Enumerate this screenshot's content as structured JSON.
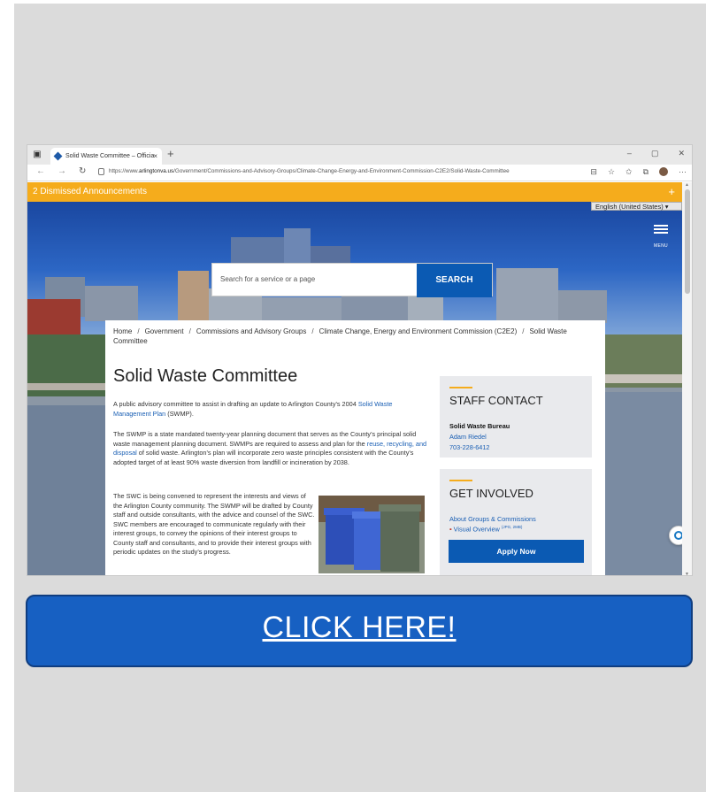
{
  "browser": {
    "tab_title": "Solid Waste Committee – Officia",
    "tab_close": "×",
    "new_tab": "+",
    "window_controls": [
      "–",
      "▢",
      "✕"
    ],
    "url_prefix": "https://www.",
    "url_domain": "arlingtonva.us",
    "url_path": "/Government/Commissions-and-Advisory-Groups/Climate-Change-Energy-and-Environment-Commission-C2E2/Solid-Waste-Committee",
    "more_icon": "···"
  },
  "page": {
    "announcement": "2 Dismissed Announcements",
    "announcement_plus": "+",
    "language": "English (United States)",
    "menu_label": "MENU",
    "search_placeholder": "Search for a service or a page",
    "search_button": "SEARCH",
    "breadcrumb": [
      "Home",
      "Government",
      "Commissions and Advisory Groups",
      "Climate Change, Energy and Environment Commission (C2E2)",
      "Solid Waste Committee"
    ],
    "breadcrumb_separator": "/",
    "title": "Solid Waste Committee",
    "intro_before_link": "A public advisory committee to assist in drafting an update to Arlington County's 2004 ",
    "intro_link": "Solid Waste Management Plan",
    "intro_after_link": " (SWMP).",
    "swmp_before_link": "The SWMP is a state mandated twenty-year planning document that serves as the County's principal solid waste management planning document. SWMPs are required to assess and plan for the ",
    "swmp_link": "reuse, recycling, and disposal",
    "swmp_after_link": " of solid waste. Arlington's plan will incorporate zero waste principles consistent with the County's adopted target of at least 90% waste diversion from landfill or incineration by 2038.",
    "swc_paragraph": "The SWC is being convened to represent the interests and views of the Arlington County community. The SWMP will be drafted by County staff and outside consultants, with the advice and counsel of the SWC. SWC members are encouraged to communicate regularly with their interest groups, to convey the opinions of their interest groups to County staff and consultants, and to provide their interest groups with periodic updates on the study's progress.",
    "staff_contact": {
      "heading": "STAFF CONTACT",
      "bureau": "Solid Waste Bureau",
      "name": "Adam Riedel",
      "phone": "703-228-6412"
    },
    "get_involved": {
      "heading": "GET INVOLVED",
      "link1": "About Groups & Commissions",
      "link2": "Visual Overview",
      "link2_note": "(JPG, 2MB)",
      "apply_button": "Apply Now"
    }
  },
  "cta": {
    "label": "CLICK HERE!"
  },
  "colors": {
    "announcement": "#f5ac1c",
    "primary_blue": "#0b5ab3",
    "cta_blue": "#1760c2",
    "link_blue": "#1a5fb4"
  }
}
